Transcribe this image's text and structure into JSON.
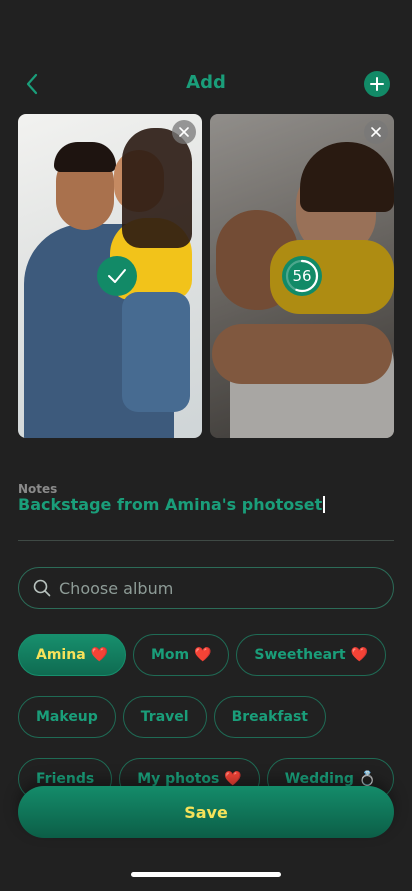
{
  "header": {
    "title": "Add",
    "back_icon": "chevron-left-icon",
    "add_icon": "plus-icon"
  },
  "photos": [
    {
      "status": "selected",
      "status_icon": "checkmark-icon",
      "remove_icon": "close-icon"
    },
    {
      "status": "uploading",
      "progress_label": "56",
      "progress": 0.56,
      "remove_icon": "close-icon"
    }
  ],
  "notes": {
    "label": "Notes",
    "value": "Backstage from Amina's photoset"
  },
  "search": {
    "placeholder": "Choose album",
    "icon": "search-icon"
  },
  "albums": {
    "rows": [
      [
        {
          "label": "Amina ❤️",
          "active": true
        },
        {
          "label": "Mom ❤️",
          "active": false
        },
        {
          "label": "Sweetheart ❤️",
          "active": false
        }
      ],
      [
        {
          "label": "Makeup",
          "active": false
        },
        {
          "label": "Travel",
          "active": false
        },
        {
          "label": "Breakfast",
          "active": false
        }
      ],
      [
        {
          "label": "Friends",
          "active": false
        },
        {
          "label": "My photos ❤️",
          "active": false
        },
        {
          "label": "Wedding 💍",
          "active": false
        }
      ]
    ]
  },
  "footer": {
    "save_label": "Save"
  },
  "colors": {
    "background": "#212121",
    "accent": "#1a9e7a",
    "accent_dark": "#128a67",
    "highlight_text": "#f6e25a"
  }
}
